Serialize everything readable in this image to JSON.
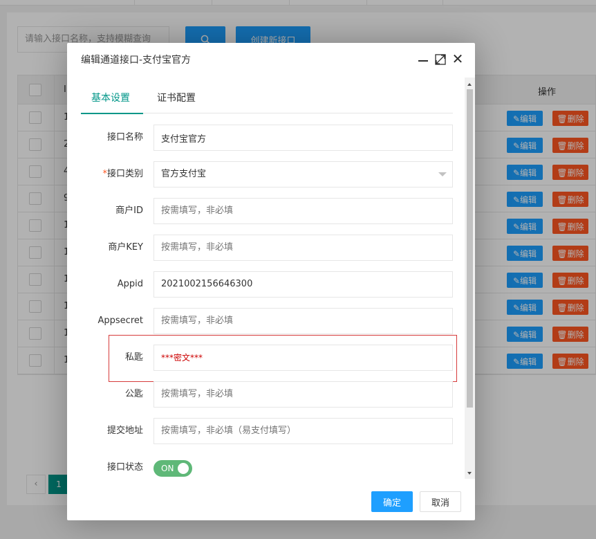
{
  "background": {
    "search": {
      "placeholder": "请输入接口名称，支持模糊查询"
    },
    "search_icon": "search-icon",
    "create_button": "创建新接口",
    "table": {
      "header_id": "I",
      "header_operation": "操作",
      "rows": [
        {
          "id": "1",
          "edit": "✎编辑",
          "delete": "🗑删除"
        },
        {
          "id": "2",
          "edit": "✎编辑",
          "delete": "🗑删除"
        },
        {
          "id": "4",
          "edit": "✎编辑",
          "delete": "🗑删除"
        },
        {
          "id": "9",
          "edit": "✎编辑",
          "delete": "🗑删除"
        },
        {
          "id": "1",
          "edit": "✎编辑",
          "delete": "🗑删除"
        },
        {
          "id": "1",
          "edit": "✎编辑",
          "delete": "🗑删除"
        },
        {
          "id": "1",
          "edit": "✎编辑",
          "delete": "🗑删除"
        },
        {
          "id": "1",
          "edit": "✎编辑",
          "delete": "🗑删除"
        },
        {
          "id": "1",
          "edit": "✎编辑",
          "delete": "🗑删除"
        },
        {
          "id": "1",
          "edit": "✎编辑",
          "delete": "🗑删除"
        }
      ]
    },
    "pager": {
      "prev": "‹",
      "current": "1"
    }
  },
  "dialog": {
    "title": "编辑通道接口-支付宝官方",
    "close_glyph": "✕",
    "tabs": [
      {
        "label": "基本设置",
        "active": true
      },
      {
        "label": "证书配置",
        "active": false
      }
    ],
    "fields": {
      "name": {
        "label": "接口名称",
        "value": "支付宝官方"
      },
      "type": {
        "required_mark": "*",
        "label": "接口类别",
        "value": "官方支付宝"
      },
      "merchant_id": {
        "label": "商户ID",
        "placeholder": "按需填写，非必填"
      },
      "merchant_key": {
        "label": "商户KEY",
        "placeholder": "按需填写，非必填"
      },
      "appid": {
        "label": "Appid",
        "value": "2021002156646300"
      },
      "appsecret": {
        "label": "Appsecret",
        "placeholder": "按需填写，非必填"
      },
      "private_key": {
        "label": "私匙",
        "value": "***密文***"
      },
      "public_key": {
        "label": "公匙",
        "placeholder": "按需填写，非必填"
      },
      "submit_url": {
        "label": "提交地址",
        "placeholder": "按需填写，非必填（易支付填写）"
      },
      "status": {
        "label": "接口状态",
        "switch_text": "ON",
        "on": true
      }
    },
    "buttons": {
      "ok": "确定",
      "cancel": "取消"
    }
  },
  "colors": {
    "primary": "#1e9fff",
    "danger": "#ff5722",
    "tab_active": "#009688",
    "switch_on": "#5fb878",
    "secret_text": "#cc0000",
    "highlight_border": "#d63a3a"
  }
}
